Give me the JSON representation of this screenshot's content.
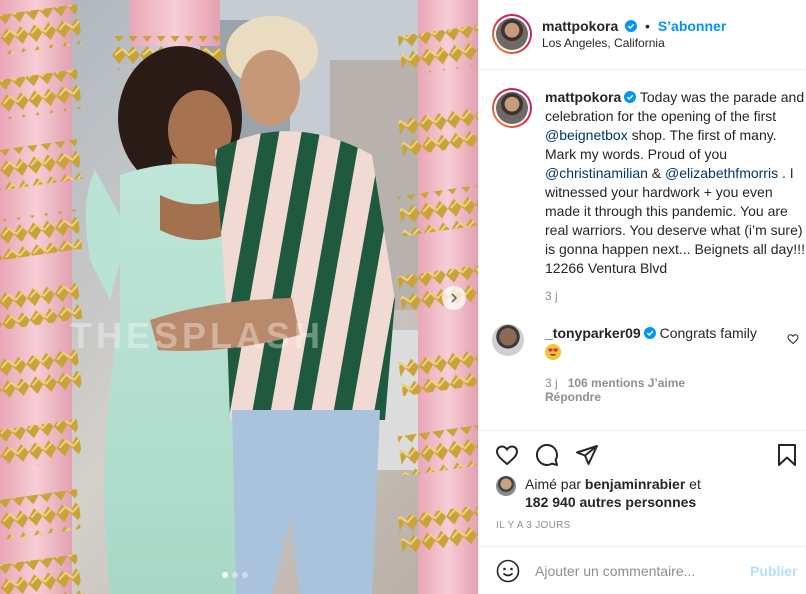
{
  "photo": {
    "icons": {
      "next": "chevron-right-icon"
    },
    "carousel_dots": 3,
    "carousel_active": 1
  },
  "header": {
    "username": "mattpokora",
    "separator": "•",
    "follow_label": "S’abonner",
    "location": "Los Angeles, California",
    "icons": {
      "verified": "verified-badge-icon"
    }
  },
  "caption": {
    "username": "mattpokora",
    "text_1": "Today was the parade and celebration for the opening of the first ",
    "mention_1": "@beignetbox",
    "text_2": " shop. The first of many. Mark my words. Proud of you ",
    "mention_2": "@christinamilian",
    "text_3": " & ",
    "mention_3": "@elizabethfmorris",
    "text_4": " . I witnessed your hardwork + you even made it through this pandemic. You are real warriors. You deserve what (i’m sure) is gonna happen next... Beignets all day!!! 12266 Ventura Blvd",
    "time": "3 j"
  },
  "comment": {
    "username": "_tonyparker09",
    "text": "Congrats family",
    "time": "3 j",
    "likes": "106 mentions J’aime",
    "reply_label": "Répondre",
    "icons": {
      "emoji": "heart-eyes-emoji-icon",
      "like": "heart-outline-icon"
    }
  },
  "actions": {
    "icons": [
      "heart-outline-icon",
      "comment-bubble-icon",
      "share-paper-plane-icon",
      "bookmark-icon"
    ]
  },
  "likes": {
    "prefix": "Aimé par ",
    "user": "benjaminrabier",
    "conj": " et",
    "others": "182 940 autres personnes"
  },
  "posted_ago": "IL Y A 3 JOURS",
  "add_comment": {
    "placeholder": "Ajouter un commentaire...",
    "post_label": "Publier",
    "icons": {
      "emoji": "smiley-face-icon"
    }
  },
  "colors": {
    "accent": "#0095f6",
    "post_disabled": "#b2dffc",
    "mention": "#00376b",
    "muted": "#8e8e8e",
    "pillar_pink": "#f2b9c6",
    "tinsel_gold": "#c9a33a"
  }
}
